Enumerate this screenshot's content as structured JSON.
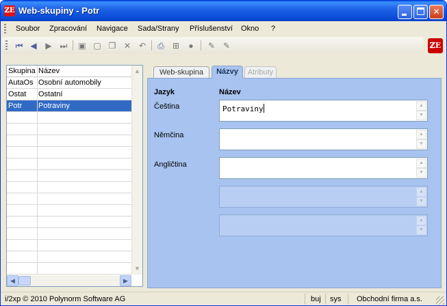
{
  "window": {
    "title": "Web-skupiny - Potr",
    "app_icon": "ℤE"
  },
  "menu": [
    "Soubor",
    "Zpracování",
    "Navigace",
    "Sada/Strany",
    "Příslušenství",
    "Okno",
    "?"
  ],
  "toolbar": {
    "icons": [
      "first-record-icon",
      "previous-record-icon",
      "next-record-icon",
      "last-record-icon",
      "save-icon",
      "new-icon",
      "copy-icon",
      "delete-icon",
      "undo-icon",
      "print-icon",
      "structure-icon",
      "info-icon",
      "edit-icon",
      "edit-field-icon"
    ],
    "logo": "ℤE"
  },
  "grid": {
    "columns": [
      "Skupina",
      "Název"
    ],
    "rows": [
      {
        "code": "AutaOs",
        "name": "Osobní automobily",
        "selected": false
      },
      {
        "code": "Ostat",
        "name": "Ostatní",
        "selected": false
      },
      {
        "code": "Potr",
        "name": "Potraviny",
        "selected": true
      }
    ]
  },
  "tabs": [
    {
      "label": "Web-skupina",
      "state": "normal"
    },
    {
      "label": "Názvy",
      "state": "active"
    },
    {
      "label": "Atributy",
      "state": "disabled"
    }
  ],
  "form": {
    "header_language": "Jazyk",
    "header_name": "Název",
    "fields": [
      {
        "label": "Čeština",
        "value": "Potraviny"
      },
      {
        "label": "Němčina",
        "value": ""
      },
      {
        "label": "Angličtina",
        "value": ""
      },
      {
        "label": "",
        "value": ""
      },
      {
        "label": "",
        "value": ""
      }
    ]
  },
  "status": {
    "copyright": "i/2xp © 2010 Polynorm Software AG",
    "user": "buj",
    "system": "sys",
    "company": "Obchodní firma a.s."
  }
}
